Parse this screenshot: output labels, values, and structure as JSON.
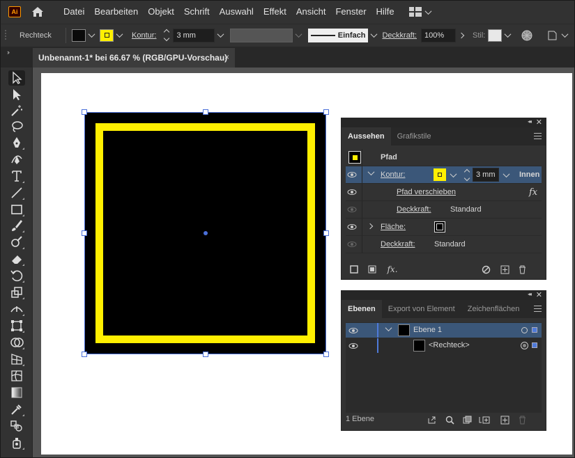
{
  "menubar": {
    "logo": "Ai",
    "items": [
      "Datei",
      "Bearbeiten",
      "Objekt",
      "Schrift",
      "Auswahl",
      "Effekt",
      "Ansicht",
      "Fenster",
      "Hilfe"
    ]
  },
  "controlbar": {
    "object_type": "Rechteck",
    "stroke_label": "Kontur:",
    "stroke_weight": "3 mm",
    "stroke_style": "Einfach",
    "opacity_label": "Deckkraft:",
    "opacity_value": "100%",
    "style_label": "Stil:"
  },
  "document": {
    "tab_title": "Unbenannt-1* bei 66.67 % (RGB/GPU-Vorschau)",
    "close": "×"
  },
  "colors": {
    "fill": "#000000",
    "stroke": "#ffef00",
    "selection": "#4a6fd9",
    "highlight_row": "#3b5779"
  },
  "appearance_panel": {
    "tabs": [
      "Aussehen",
      "Grafikstile"
    ],
    "header": "Pfad",
    "stroke_row": {
      "label": "Kontur:",
      "weight": "3 mm",
      "align": "Innen"
    },
    "effect_row": {
      "label": "Pfad verschieben",
      "fx": "fx"
    },
    "stroke_opacity_row": {
      "label": "Deckkraft:",
      "value": "Standard"
    },
    "fill_row": {
      "label": "Fläche:"
    },
    "opacity_row": {
      "label": "Deckkraft:",
      "value": "Standard"
    },
    "footer_fx": "fx."
  },
  "layers_panel": {
    "tabs": [
      "Ebenen",
      "Export von Element",
      "Zeichenflächen"
    ],
    "layers": [
      {
        "name": "Ebene 1"
      },
      {
        "name": "<Rechteck>"
      }
    ],
    "count_text": "1 Ebene"
  },
  "tools": [
    "selection-tool-icon",
    "direct-selection-tool-icon",
    "magic-wand-icon",
    "lasso-icon",
    "pen-tool-icon",
    "curvature-tool-icon",
    "type-tool-icon",
    "line-tool-icon",
    "rectangle-tool-icon",
    "paintbrush-icon",
    "blob-brush-icon",
    "eraser-icon",
    "rotate-tool-icon",
    "scale-tool-icon",
    "width-tool-icon",
    "free-transform-icon",
    "shape-builder-icon",
    "perspective-grid-icon",
    "mesh-tool-icon",
    "gradient-tool-icon",
    "eyedropper-icon",
    "blend-tool-icon",
    "symbol-sprayer-icon"
  ]
}
